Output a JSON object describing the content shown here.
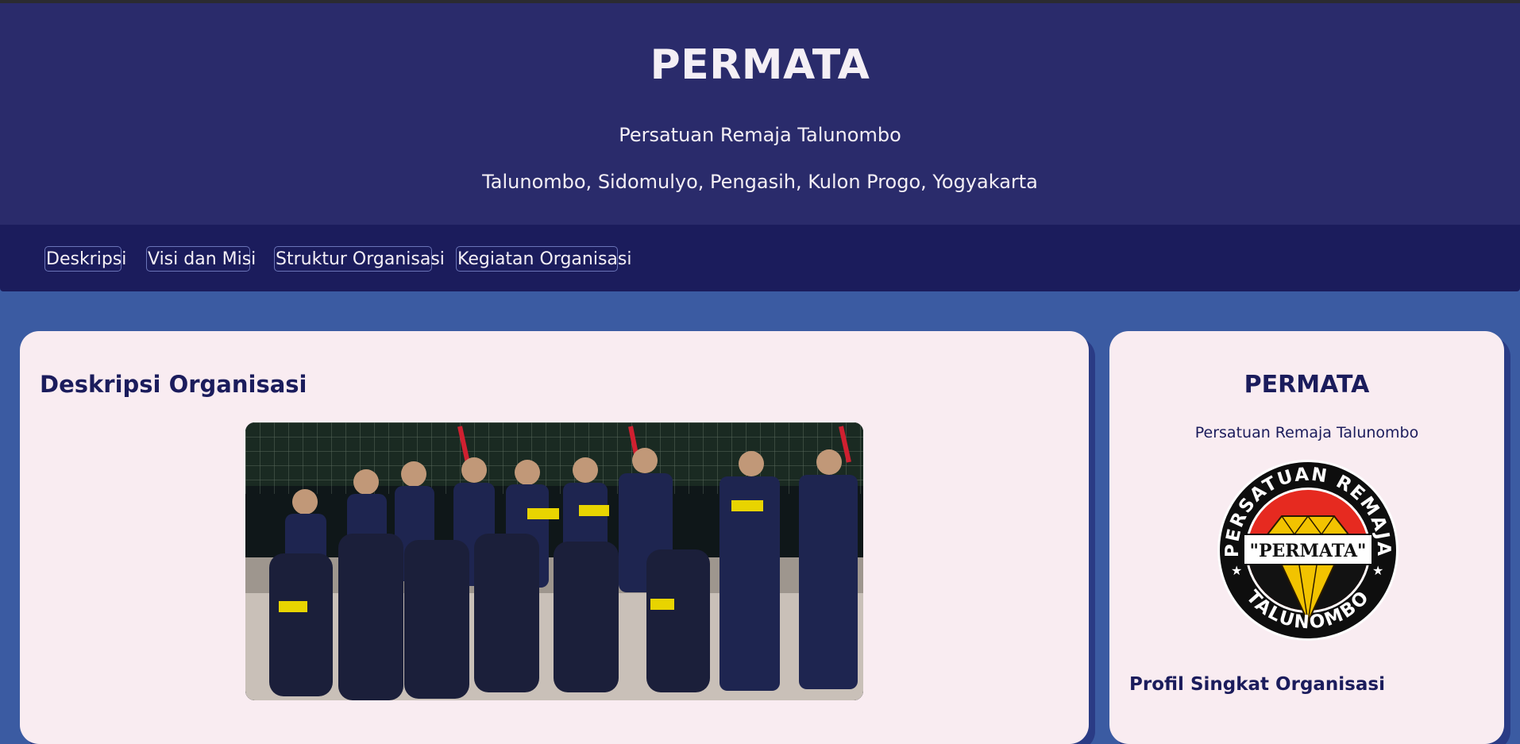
{
  "header": {
    "title": "PERMATA",
    "subtitle": "Persatuan Remaja Talunombo",
    "address": "Talunombo, Sidomulyo, Pengasih, Kulon Progo, Yogyakarta"
  },
  "nav": {
    "items": [
      {
        "label": "Deskripsi"
      },
      {
        "label": "Visi dan Misi"
      },
      {
        "label": "Struktur Organisasi"
      },
      {
        "label": "Kegiatan Organisasi"
      }
    ]
  },
  "main": {
    "section_title": "Deskripsi Organisasi"
  },
  "sidebar": {
    "title": "PERMATA",
    "subtitle": "Persatuan Remaja Talunombo",
    "logo": {
      "text_top": "PERSATUAN REMAJA",
      "text_center": "\"PERMATA\"",
      "text_bottom": "TALUNOMBO"
    },
    "section_heading": "Profil Singkat Organisasi"
  },
  "colors": {
    "header_bg": "#2a2b6b",
    "nav_bg": "#1b1c5c",
    "page_bg": "#3b5ba2",
    "card_bg": "#f9ecf1",
    "heading_text": "#1b1c5c"
  }
}
